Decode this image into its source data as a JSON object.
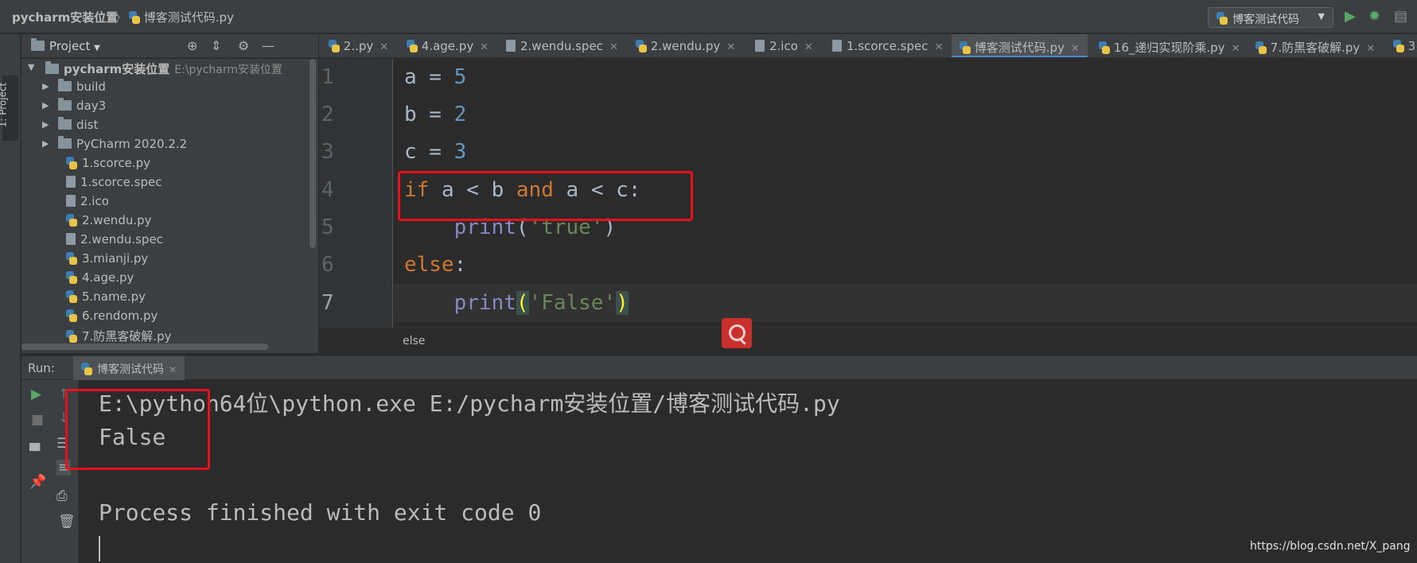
{
  "breadcrumb": {
    "project": "pycharm安装位置",
    "file": "博客测试代码.py"
  },
  "run_config": {
    "label": "博客测试代码"
  },
  "toolbar": {
    "run_icon": "run-icon",
    "debug_icon": "debug-icon"
  },
  "left_strip": {
    "label": "1: Project"
  },
  "project_panel": {
    "title": "Project",
    "root": {
      "name": "pycharm安装位置",
      "path": "E:\\pycharm安装位置"
    },
    "folders": [
      "build",
      "day3",
      "dist",
      "PyCharm 2020.2.2"
    ],
    "files": [
      {
        "name": "1.scorce.py",
        "type": "py"
      },
      {
        "name": "1.scorce.spec",
        "type": "spec"
      },
      {
        "name": "2.ico",
        "type": "ico"
      },
      {
        "name": "2.wendu.py",
        "type": "py"
      },
      {
        "name": "2.wendu.spec",
        "type": "spec"
      },
      {
        "name": "3.mianji.py",
        "type": "py"
      },
      {
        "name": "4.age.py",
        "type": "py"
      },
      {
        "name": "5.name.py",
        "type": "py"
      },
      {
        "name": "6.rendom.py",
        "type": "py"
      },
      {
        "name": "7.防黑客破解.py",
        "type": "py"
      }
    ]
  },
  "tabs": [
    {
      "label": "2..py"
    },
    {
      "label": "4.age.py"
    },
    {
      "label": "2.wendu.spec"
    },
    {
      "label": "2.wendu.py"
    },
    {
      "label": "2.ico"
    },
    {
      "label": "1.scorce.spec"
    },
    {
      "label": "博客测试代码.py",
      "active": true
    },
    {
      "label": "16_递归实现阶乘.py"
    },
    {
      "label": "7.防黑客破解.py"
    },
    {
      "label": "3"
    }
  ],
  "editor": {
    "line_numbers": [
      "1",
      "2",
      "3",
      "4",
      "5",
      "6",
      "7"
    ],
    "lines": [
      {
        "a": "a",
        "op": " = ",
        "val": "5"
      },
      {
        "a": "b",
        "op": " = ",
        "val": "2"
      },
      {
        "a": "c",
        "op": " = ",
        "val": "3"
      },
      {
        "kw1": "if",
        "t1": " a < b ",
        "kw2": "and",
        "t2": " a < c:"
      },
      {
        "indent": "    ",
        "fn": "print",
        "open": "(",
        "str": "'true'",
        "close": ")"
      },
      {
        "kw": "else",
        "rest": ":"
      },
      {
        "indent": "    ",
        "fn": "print",
        "open": "(",
        "str": "'False'",
        "close": ")"
      }
    ],
    "context_breadcrumb": "else"
  },
  "run_panel": {
    "label": "Run:",
    "tab": "博客测试代码",
    "output": [
      "E:\\python64位\\python.exe E:/pycharm安装位置/博客测试代码.py",
      "False",
      "",
      "Process finished with exit code 0"
    ]
  },
  "watermark": "https://blog.csdn.net/X_pang",
  "colors": {
    "highlight_box": "#e8101b",
    "keyword": "#cc7832",
    "number": "#6897bb",
    "string": "#6a8759",
    "builtin": "#8888c6"
  }
}
